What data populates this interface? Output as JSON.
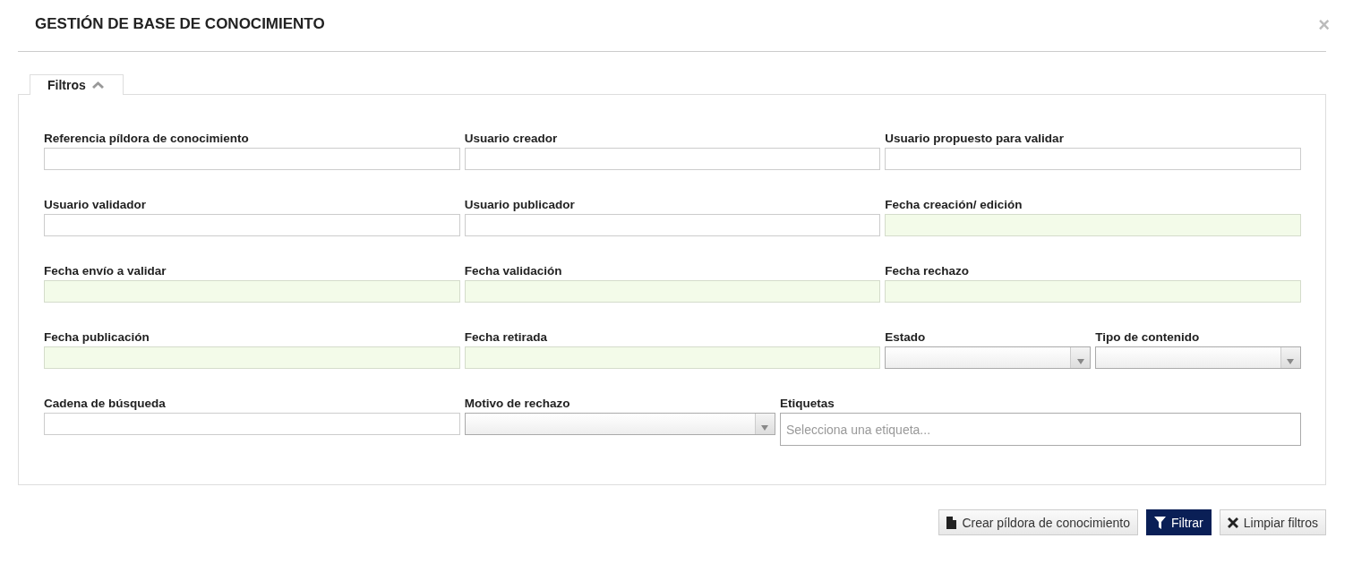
{
  "window": {
    "title": "GESTIÓN DE BASE DE CONOCIMIENTO",
    "close": "×"
  },
  "filters_tab": {
    "label": "Filtros",
    "expanded": true
  },
  "fields": [
    {
      "label": "Referencia píldora de conocimiento",
      "kind": "text"
    },
    {
      "label": "Usuario creador",
      "kind": "text"
    },
    {
      "label": "Usuario propuesto para validar",
      "kind": "text"
    },
    {
      "label": "Usuario validador",
      "kind": "text"
    },
    {
      "label": "Usuario publicador",
      "kind": "text"
    },
    {
      "label": "Fecha creación/ edición",
      "kind": "date"
    },
    {
      "label": "Fecha envío a validar",
      "kind": "date"
    },
    {
      "label": "Fecha validación",
      "kind": "date"
    },
    {
      "label": "Fecha rechazo",
      "kind": "date"
    },
    {
      "label": "Fecha publicación",
      "kind": "date"
    },
    {
      "label": "Fecha retirada",
      "kind": "date"
    },
    {
      "label": "Estado",
      "kind": "select"
    },
    {
      "label": "Tipo de contenido",
      "kind": "select"
    },
    {
      "label": "Cadena de búsqueda",
      "kind": "text"
    },
    {
      "label": "Motivo de rechazo",
      "kind": "select"
    },
    {
      "label": "Etiquetas",
      "kind": "tags",
      "placeholder": "Selecciona una etiqueta..."
    }
  ],
  "buttons": [
    {
      "label": "Crear píldora de conocimiento",
      "kind": "create"
    },
    {
      "label": "Filtrar",
      "kind": "filter"
    },
    {
      "label": "Limpiar filtros",
      "kind": "clear"
    }
  ]
}
